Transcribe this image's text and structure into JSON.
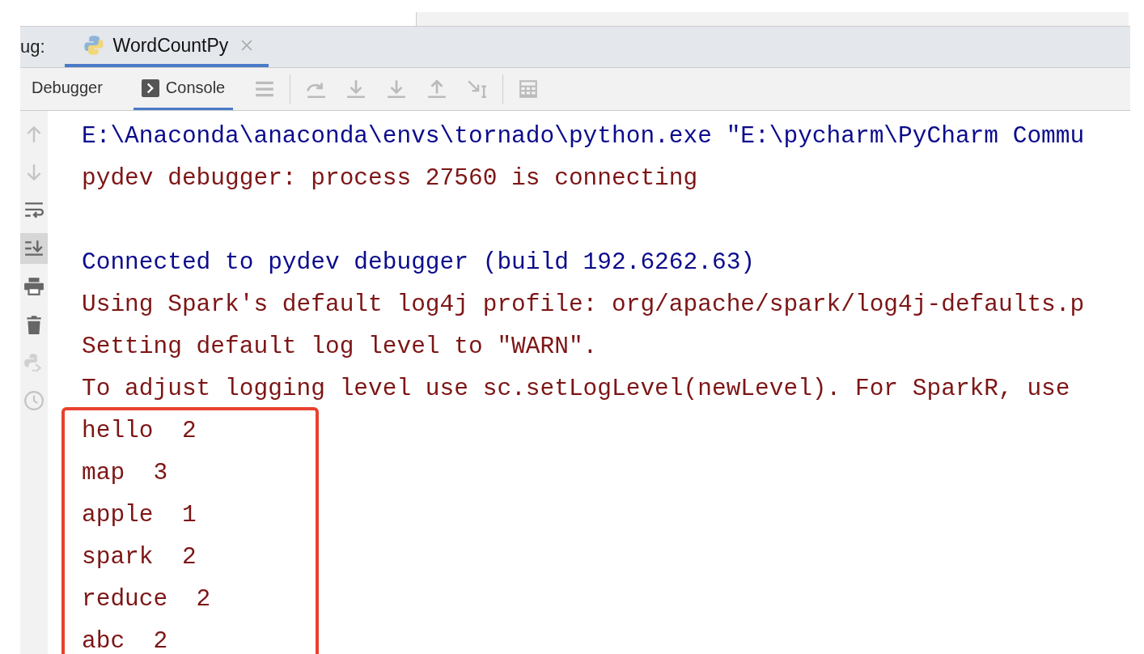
{
  "debug_bar": {
    "label": "ug:",
    "tabs": [
      {
        "label": "WordCountPy",
        "selected": true
      }
    ]
  },
  "toolbar": {
    "tabs": [
      {
        "label": "Debugger",
        "selected": false
      },
      {
        "label": "Console",
        "selected": true
      }
    ]
  },
  "side_tools": {
    "scroll_to_end_on": true
  },
  "console": {
    "lines": [
      {
        "kind": "command",
        "text": "E:\\Anaconda\\anaconda\\envs\\tornado\\python.exe \"E:\\pycharm\\PyCharm Commu"
      },
      {
        "kind": "output",
        "text": "pydev debugger: process 27560 is connecting"
      },
      {
        "kind": "blank"
      },
      {
        "kind": "command",
        "text": "Connected to pydev debugger (build 192.6262.63)"
      },
      {
        "kind": "output",
        "text": "Using Spark's default log4j profile: org/apache/spark/log4j-defaults.p"
      },
      {
        "kind": "output",
        "text": "Setting default log level to \"WARN\"."
      },
      {
        "kind": "output",
        "text": "To adjust logging level use sc.setLogLevel(newLevel). For SparkR, use"
      },
      {
        "kind": "output",
        "text": "hello  2"
      },
      {
        "kind": "output",
        "text": "map  3"
      },
      {
        "kind": "output",
        "text": "apple  1"
      },
      {
        "kind": "output",
        "text": "spark  2"
      },
      {
        "kind": "output",
        "text": "reduce  2"
      },
      {
        "kind": "output",
        "text": "abc  2"
      }
    ]
  }
}
